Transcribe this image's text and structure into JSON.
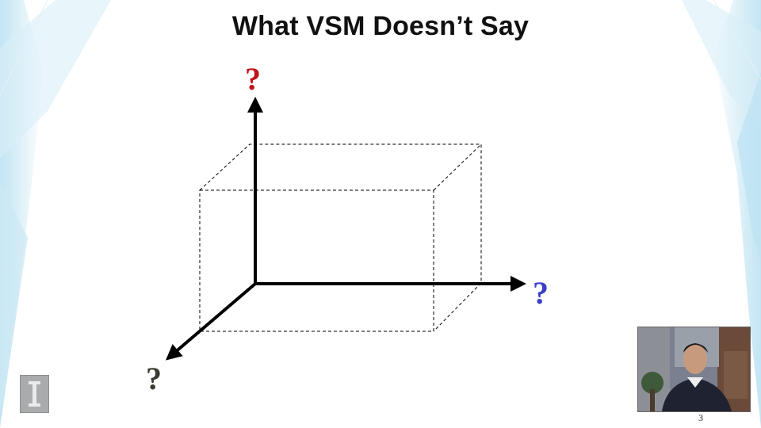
{
  "slide": {
    "title": "What VSM Doesn’t Say",
    "page_number": "3"
  },
  "diagram": {
    "axes": [
      {
        "name": "vertical-axis",
        "label": "?",
        "color": "#c0141b"
      },
      {
        "name": "horizontal-axis",
        "label": "?",
        "color": "#3b3fc8"
      },
      {
        "name": "depth-axis",
        "label": "?",
        "color": "#3a3a2e"
      }
    ],
    "box_style": "dashed"
  },
  "decor": {
    "logo_icon": "institution-logo-icon",
    "webcam_icon": "presenter-webcam-icon"
  },
  "colors": {
    "background": "#ffffff",
    "decor_blue": "#bfe3f2"
  }
}
